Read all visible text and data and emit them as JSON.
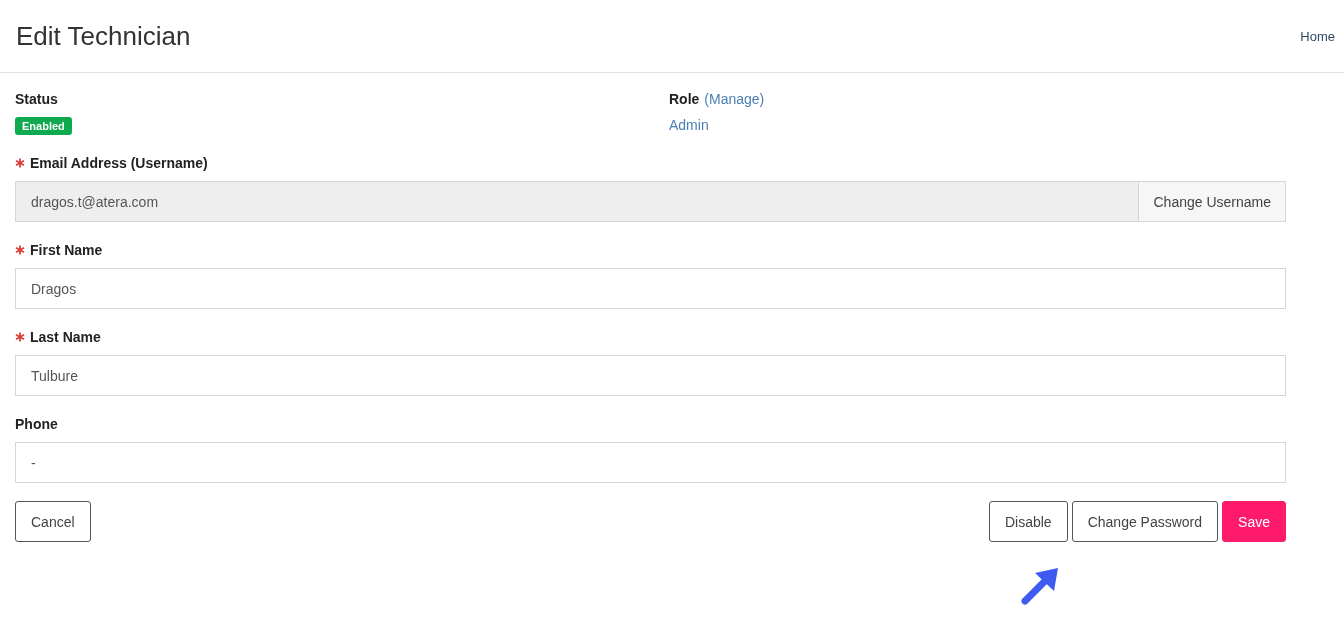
{
  "header": {
    "title": "Edit Technician",
    "breadcrumb": "Home"
  },
  "status": {
    "label": "Status",
    "badge": "Enabled",
    "enabled": true
  },
  "role": {
    "label": "Role",
    "manage_link": "(Manage)",
    "value": "Admin"
  },
  "fields": [
    {
      "label": "Email Address (Username)",
      "required": true,
      "value": "dragos.t@atera.com",
      "disabled": true,
      "addon": "Change Username"
    },
    {
      "label": "First Name",
      "required": true,
      "value": "Dragos",
      "disabled": false
    },
    {
      "label": "Last Name",
      "required": true,
      "value": "Tulbure",
      "disabled": false
    },
    {
      "label": "Phone",
      "required": false,
      "value": "-",
      "disabled": false
    }
  ],
  "actions": {
    "left": [
      {
        "label": "Cancel",
        "kind": "outline"
      }
    ],
    "right": [
      {
        "label": "Disable",
        "kind": "outline"
      },
      {
        "label": "Change Password",
        "kind": "outline"
      },
      {
        "label": "Save",
        "kind": "primary"
      }
    ]
  }
}
